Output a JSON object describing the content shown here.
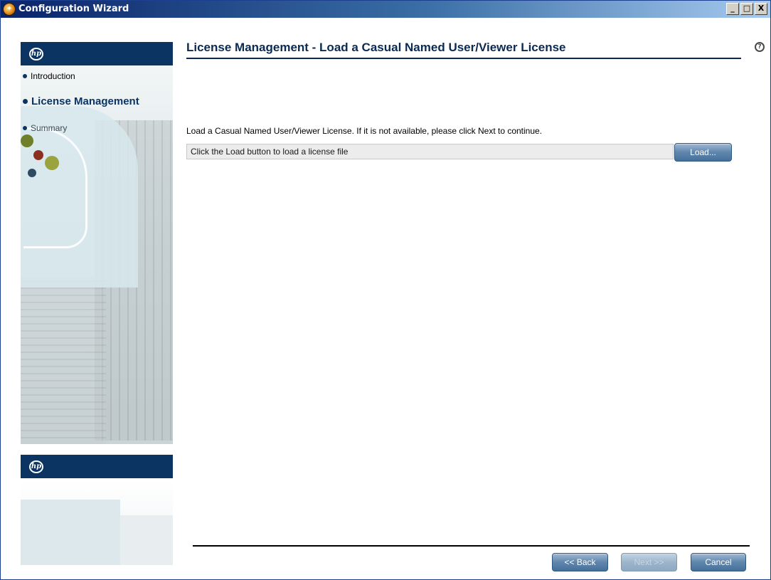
{
  "window": {
    "title": "Configuration Wizard",
    "buttons": {
      "minimize": "_",
      "maximize": "□",
      "close": "X"
    }
  },
  "sidebar": {
    "logo_text": "hp",
    "items": [
      {
        "label": "Introduction",
        "state": "completed"
      },
      {
        "label": "License Management",
        "state": "current"
      },
      {
        "label": "Summary",
        "state": "pending"
      }
    ]
  },
  "main": {
    "title": "License Management - Load a Casual Named User/Viewer License",
    "help_icon": "?",
    "instruction": "Load a Casual Named User/Viewer License. If it is not available, please click Next to continue.",
    "license_field": {
      "value": "Click the Load button to load a license file"
    },
    "load_button": "Load..."
  },
  "footer": {
    "back_button": "<< Back",
    "next_button": "Next >>",
    "cancel_button": "Cancel"
  },
  "colors": {
    "accent": "#0b3463",
    "title_bar": "#0a246a",
    "button": "#5f86ad"
  }
}
